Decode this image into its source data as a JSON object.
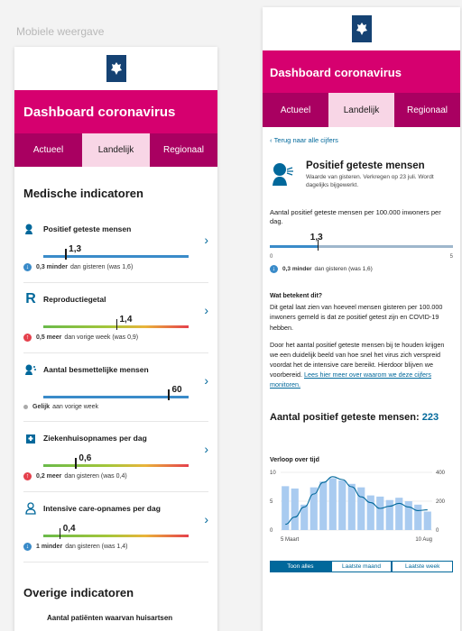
{
  "caption": "Mobiele weergave",
  "left": {
    "header_title": "Dashboard coronavirus",
    "tabs": [
      {
        "label": "Actueel"
      },
      {
        "label": "Landelijk"
      },
      {
        "label": "Regionaal"
      }
    ],
    "active_tab": 1,
    "section_title": "Medische indicatoren",
    "indicators": [
      {
        "icon": "person-coughing-icon",
        "title": "Positief geteste mensen",
        "value": "1,3",
        "fraction": 0.15,
        "bar": "blue",
        "note_bold": "0,3 minder",
        "note": "dan gisteren (was 1,6)",
        "trend": "down"
      },
      {
        "icon": "reproduction-r-icon",
        "title": "Reproductiegetal",
        "value": "1,4",
        "fraction": 0.5,
        "bar": "gradient",
        "note_bold": "0,5 meer",
        "note": "dan vorige week (was 0,9)",
        "trend": "up"
      },
      {
        "icon": "contagious-person-icon",
        "title": "Aantal besmettelijke mensen",
        "value": "60",
        "fraction": 0.86,
        "bar": "blue",
        "note_bold": "Gelijk",
        "note": "aan vorige week",
        "trend": "equal"
      },
      {
        "icon": "hospital-icon",
        "title": "Ziekenhuisopnames per dag",
        "value": "0,6",
        "fraction": 0.22,
        "bar": "gradient",
        "note_bold": "0,2 meer",
        "note": "dan gisteren (was 0,4)",
        "trend": "up"
      },
      {
        "icon": "intensive-care-icon",
        "title": "Intensive care-opnames per dag",
        "value": "0,4",
        "fraction": 0.11,
        "bar": "gradient",
        "note_bold": "1 minder",
        "note": "dan gisteren (was 1,4)",
        "trend": "down"
      }
    ],
    "overige_title": "Overige indicatoren",
    "overige_first": "Aantal patiënten waarvan huisartsen"
  },
  "right": {
    "header_title": "Dashboard coronavirus",
    "tabs": [
      {
        "label": "Actueel"
      },
      {
        "label": "Landelijk"
      },
      {
        "label": "Regionaal"
      }
    ],
    "active_tab": 1,
    "back_link": "Terug naar alle cijfers",
    "hero_title": "Positief geteste mensen",
    "hero_sub": "Waarde van gisteren. Verkregen op 23 juli. Wordt dagelijks bijgewerkt.",
    "per100_label": "Aantal positief geteste mensen per 100.000 inwoners per dag.",
    "value": "1,3",
    "fraction": 0.26,
    "scale_min": "0",
    "scale_max": "5",
    "note_bold": "0,3 minder",
    "note": "dan gisteren (was 1,6)",
    "what_title": "Wat betekent dit?",
    "what_text": "Dit getal laat zien van hoeveel mensen gisteren per 100.000 inwoners gemeld is dat ze positief getest zijn en COVID-19 hebben.",
    "body2": "Door het aantal positief geteste mensen bij te houden krijgen we een duidelijk beeld van hoe snel het virus zich verspreid voordat het de intensive care bereikt. Hierdoor blijven we voorbereid.",
    "link_text": "Lees hier meer over waarom we deze cijfers monitoren.",
    "count_label": "Aantal positief geteste mensen:",
    "count_value": "223",
    "chart_title": "Verloop over tijd",
    "range_buttons": [
      {
        "label": "Toon alles"
      },
      {
        "label": "Laatste maand"
      },
      {
        "label": "Laatste week"
      }
    ],
    "active_range": 0
  },
  "chart_data": {
    "type": "bar",
    "title": "Verloop over tijd",
    "x_start_label": "5 Maart",
    "x_end_label": "10 Aug",
    "left_axis_ticks": [
      "0",
      "5",
      "10"
    ],
    "right_axis_ticks": [
      "0",
      "200",
      "400"
    ],
    "ylim_left": [
      0,
      10
    ],
    "ylim_right": [
      0,
      400
    ],
    "series": [
      {
        "type": "bar",
        "values": [
          7.6,
          7.2,
          4.4,
          7.4,
          8.4,
          9.0,
          8.6,
          8.0,
          7.4,
          6.0,
          5.8,
          5.2,
          5.6,
          5.0,
          4.4,
          3.2
        ]
      },
      {
        "type": "line",
        "values": [
          40,
          90,
          160,
          250,
          330,
          370,
          350,
          300,
          230,
          190,
          150,
          165,
          185,
          160,
          135,
          140
        ]
      }
    ],
    "colors": {
      "bars": "#a9cbf0",
      "line": "#01689b"
    }
  }
}
